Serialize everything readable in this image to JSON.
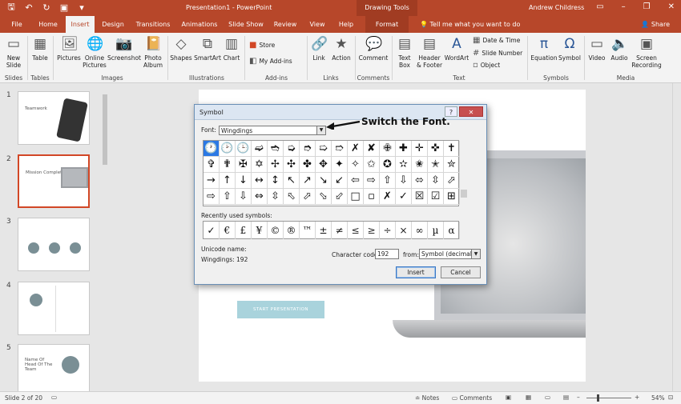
{
  "window": {
    "title": "Presentation1 - PowerPoint",
    "context_tab": "Drawing Tools",
    "user": "Andrew Childress",
    "tell_me": "Tell me what you want to do",
    "share": "Share"
  },
  "tabs": [
    "File",
    "Home",
    "Insert",
    "Design",
    "Transitions",
    "Animations",
    "Slide Show",
    "Review",
    "View",
    "Help",
    "Format"
  ],
  "ribbon": {
    "buttons": {
      "new_slide": "New Slide",
      "table": "Table",
      "pictures": "Pictures",
      "online_pictures": "Online Pictures",
      "screenshot": "Screenshot",
      "photo_album": "Photo Album",
      "shapes": "Shapes",
      "smartart": "SmartArt",
      "chart": "Chart",
      "store": "Store",
      "my_addins": "My Add-ins",
      "link": "Link",
      "action": "Action",
      "comment": "Comment",
      "text_box": "Text Box",
      "header_footer": "Header & Footer",
      "wordart": "WordArt",
      "date_time": "Date & Time",
      "slide_number": "Slide Number",
      "object": "Object",
      "equation": "Equation",
      "symbol": "Symbol",
      "video": "Video",
      "audio": "Audio",
      "screen_recording": "Screen Recording"
    },
    "groups": {
      "slides": "Slides",
      "tables": "Tables",
      "images": "Images",
      "illustrations": "Illustrations",
      "addins": "Add-ins",
      "links": "Links",
      "comments": "Comments",
      "text": "Text",
      "symbols": "Symbols",
      "media": "Media"
    }
  },
  "thumbnails": [
    {
      "num": "1",
      "text": "Teamwork"
    },
    {
      "num": "2",
      "text": "Mission Complete"
    },
    {
      "num": "3",
      "text": ""
    },
    {
      "num": "4",
      "text": ""
    },
    {
      "num": "5",
      "text": "Name Of Head Of The Team"
    }
  ],
  "slide": {
    "button": "START PRESENTATION"
  },
  "dialog": {
    "title": "Symbol",
    "font_label": "Font:",
    "font_value": "Wingdings",
    "symbols": [
      "🕐",
      "🕑",
      "🕒",
      "➫",
      "➬",
      "➭",
      "➮",
      "➯",
      "➱",
      "✗",
      "✘",
      "✙",
      "✚",
      "✛",
      "✜",
      "✝",
      "✞",
      "✟",
      "✠",
      "✡",
      "✢",
      "✣",
      "✤",
      "✥",
      "✦",
      "✧",
      "✩",
      "✪",
      "✫",
      "✬",
      "✭",
      "✮",
      "→",
      "↑",
      "↓",
      "↔",
      "↕",
      "↖",
      "↗",
      "↘",
      "↙",
      "⇦",
      "⇨",
      "⇧",
      "⇩",
      "⬄",
      "⇳",
      "⬀",
      "⇨",
      "⇧",
      "⇩",
      "⇔",
      "⇳",
      "⬁",
      "⬀",
      "⬂",
      "⬃",
      "□",
      "▫",
      "✗",
      "✓",
      "☒",
      "☑",
      "⊞"
    ],
    "recent_label": "Recently used symbols:",
    "recent": [
      "✓",
      "€",
      "£",
      "¥",
      "©",
      "®",
      "™",
      "±",
      "≠",
      "≤",
      "≥",
      "÷",
      "×",
      "∞",
      "µ",
      "α"
    ],
    "unicode_name_label": "Unicode name:",
    "unicode_value": "Wingdings: 192",
    "char_code_label": "Character code:",
    "char_code": "192",
    "from_label": "from:",
    "from_value": "Symbol (decimal)",
    "insert": "Insert",
    "cancel": "Cancel",
    "help": "?",
    "close": "✕"
  },
  "annotation": "Switch the Font.",
  "status": {
    "slide_info": "Slide 2 of 20",
    "notes": "Notes",
    "comments": "Comments",
    "zoom": "54%"
  }
}
